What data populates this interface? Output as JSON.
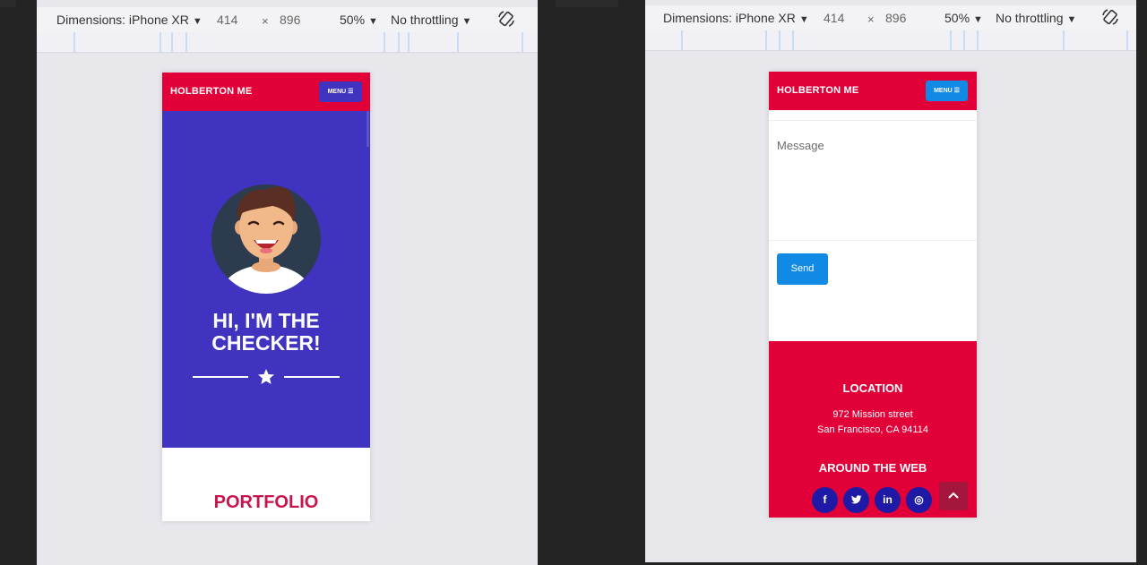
{
  "devtools": [
    {
      "dimensions_label": "Dimensions: iPhone XR",
      "width": "414",
      "times": "×",
      "height": "896",
      "zoom": "50%",
      "throttling": "No throttling"
    },
    {
      "dimensions_label": "Dimensions: iPhone XR",
      "width": "414",
      "times": "×",
      "height": "896",
      "zoom": "50%",
      "throttling": "No throttling"
    }
  ],
  "site": {
    "brand": "HOLBERTON ME",
    "menu_label": "MENU ☰",
    "hero_title_line1": "HI, I'M THE",
    "hero_title_line2": "CHECKER!",
    "portfolio_heading": "PORTFOLIO",
    "message_placeholder": "Message",
    "send_label": "Send",
    "location_heading": "LOCATION",
    "address_line1": "972 Mission street",
    "address_line2": "San Francisco, CA 94114",
    "web_heading": "AROUND THE WEB",
    "social": [
      "facebook-icon",
      "twitter-icon",
      "linkedin-icon",
      "dribbble-icon"
    ],
    "social_glyphs": [
      "f",
      "t",
      "in",
      "◎"
    ]
  },
  "colors": {
    "nav": "#e10037",
    "hero": "#3f33bf",
    "send": "#118ae5",
    "social": "#1e1aa6",
    "portfolio": "#c6164b"
  }
}
